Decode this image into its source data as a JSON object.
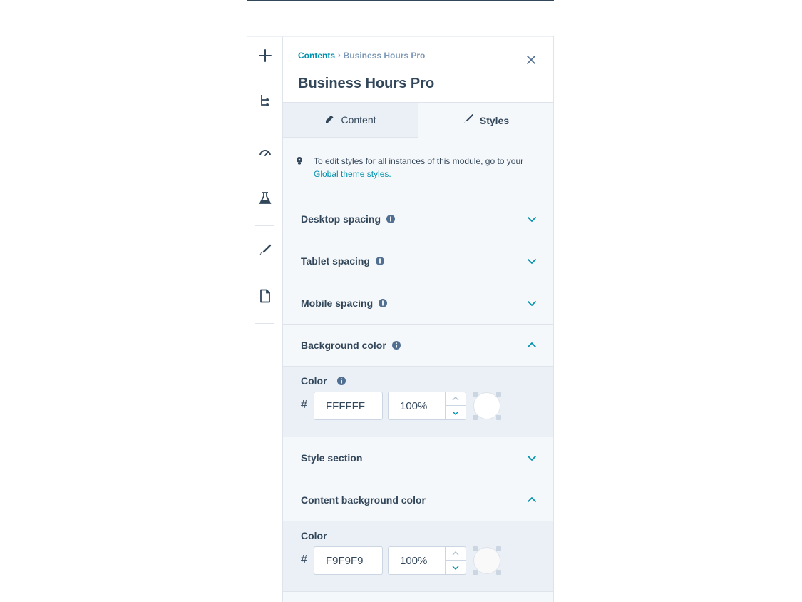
{
  "breadcrumb": {
    "root": "Contents",
    "separator": "›",
    "current": "Business Hours Pro"
  },
  "title": "Business Hours Pro",
  "tabs": [
    {
      "label": "Content",
      "icon": "pencil-icon",
      "active": false
    },
    {
      "label": "Styles",
      "icon": "brush-icon",
      "active": true
    }
  ],
  "notice": {
    "text": "To edit styles for all instances of this module, go to your",
    "link": "Global theme styles."
  },
  "sections": {
    "desktop_spacing": {
      "label": "Desktop spacing"
    },
    "tablet_spacing": {
      "label": "Tablet spacing"
    },
    "mobile_spacing": {
      "label": "Mobile spacing"
    },
    "background_color": {
      "label": "Background color"
    },
    "style_section": {
      "label": "Style section"
    },
    "content_background_color": {
      "label": "Content background color"
    }
  },
  "background_color_field": {
    "label": "Color",
    "hash": "#",
    "hex": "FFFFFF",
    "opacity": "100%",
    "swatch": "#ffffff"
  },
  "content_background_color_field": {
    "label": "Color",
    "hash": "#",
    "hex": "F9F9F9",
    "opacity": "100%",
    "swatch": "#f9f9f9"
  },
  "rail_icons": [
    "plus-icon",
    "tree-icon",
    "gauge-icon",
    "flask-icon",
    "brush-icon",
    "document-icon"
  ],
  "colors": {
    "accent": "#0091ae",
    "text": "#33475b",
    "border": "#dfe3eb"
  }
}
